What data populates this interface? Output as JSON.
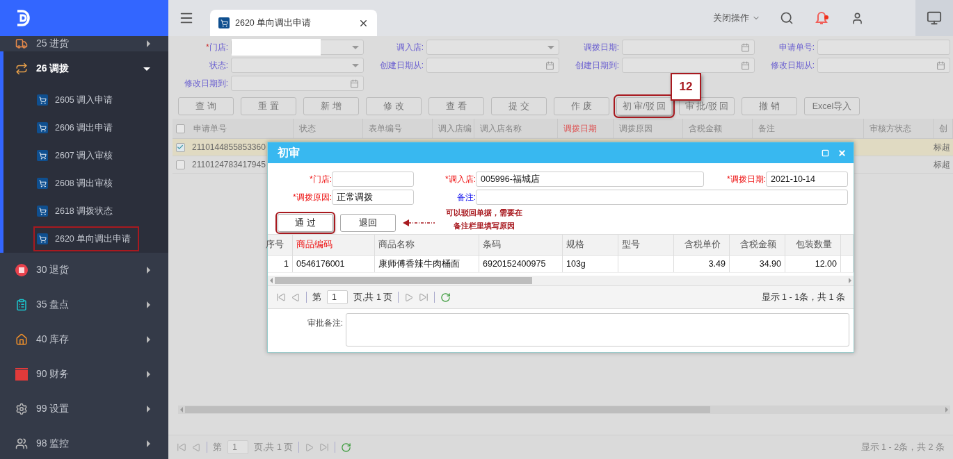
{
  "sidebar": {
    "items": [
      {
        "label": "25 进货",
        "expanded": false
      },
      {
        "label": "26 调拨",
        "expanded": true,
        "children": [
          {
            "label": "2605 调入申请",
            "annotated": false
          },
          {
            "label": "2606 调出申请",
            "annotated": false
          },
          {
            "label": "2607 调入审核",
            "annotated": false
          },
          {
            "label": "2608 调出审核",
            "annotated": false
          },
          {
            "label": "2618 调拨状态",
            "annotated": false
          },
          {
            "label": "2620 单向调出申请",
            "annotated": true
          }
        ]
      },
      {
        "label": "30 退货",
        "expanded": false
      },
      {
        "label": "35 盘点",
        "expanded": false
      },
      {
        "label": "40 库存",
        "expanded": false
      },
      {
        "label": "90 财务",
        "expanded": false
      },
      {
        "label": "99 设置",
        "expanded": false
      },
      {
        "label": "98 监控",
        "expanded": false
      }
    ]
  },
  "header": {
    "tabs": [
      {
        "label": "2620 单向调出申请",
        "selected": true
      }
    ],
    "close_menu": "关闭操作"
  },
  "filters": [
    {
      "marker": "*",
      "label": "门店:",
      "kind": "select"
    },
    {
      "label": "调入店:",
      "kind": "select"
    },
    {
      "label": "调拨日期:",
      "kind": "date"
    },
    {
      "label": "申请单号:",
      "kind": "text"
    },
    {
      "label": "状态:",
      "kind": "select"
    },
    {
      "label": "创建日期从:",
      "kind": "date"
    },
    {
      "label": "创建日期到:",
      "kind": "date"
    },
    {
      "label": "修改日期从:",
      "kind": "date"
    },
    {
      "label": "修改日期到:",
      "kind": "date"
    }
  ],
  "toolbar": {
    "buttons": [
      {
        "label": "查 询",
        "annotated": false
      },
      {
        "label": "重 置",
        "annotated": false
      },
      {
        "label": "新 增",
        "annotated": false
      },
      {
        "label": "修 改",
        "annotated": false
      },
      {
        "label": "查 看",
        "annotated": false
      },
      {
        "label": "提 交",
        "annotated": false
      },
      {
        "label": "作 废",
        "annotated": false
      },
      {
        "label": "初 审/驳 回",
        "annotated": true
      },
      {
        "label": "审 批/驳 回",
        "annotated": false
      },
      {
        "label": "撤 销",
        "annotated": false
      },
      {
        "label": "Excel导入",
        "annotated": false
      }
    ],
    "callout": "12"
  },
  "table": {
    "all_selected": false,
    "columns": [
      {
        "label": "申请单号",
        "required": false
      },
      {
        "label": "状态",
        "required": false
      },
      {
        "label": "表单编号",
        "required": false
      },
      {
        "label": "调入店编",
        "required": false
      },
      {
        "label": "调入店名称",
        "required": false
      },
      {
        "label": "调拨日期",
        "required": true
      },
      {
        "label": "调拨原因",
        "required": false
      },
      {
        "label": "含税金额",
        "required": false
      },
      {
        "label": "备注",
        "required": false
      },
      {
        "label": "审核方状态",
        "required": false
      },
      {
        "label": "创",
        "required": false
      }
    ],
    "rows": [
      {
        "selected": true,
        "order_no": "2110144855853360",
        "column_last": "标超"
      },
      {
        "selected": false,
        "order_no": "2110124783417945",
        "column_last": "标超"
      }
    ]
  },
  "pager": {
    "prefix": "第",
    "page": "1",
    "suffix": "页,共 1 页",
    "summary": "显示 1 - 2条，共 2 条"
  },
  "dialog": {
    "title": "初审",
    "fields": [
      {
        "label": "*门店:",
        "required": true
      },
      {
        "label": "*调入店:",
        "value": "005996-福城店",
        "required": true
      },
      {
        "label": "*调拨日期:",
        "value": "2021-10-14",
        "required": true
      },
      {
        "label": "*调拨原因:",
        "value": "正常调拨",
        "required": true
      },
      {
        "label": "备注:",
        "required": false
      }
    ],
    "buttons": [
      {
        "label": "通 过",
        "annotated": true
      },
      {
        "label": "退回",
        "annotated": false
      }
    ],
    "note": [
      "可以驳回单据，需要在",
      "备注栏里填写原因"
    ],
    "table": {
      "columns": [
        {
          "label": "序号",
          "required": false,
          "numeric": true
        },
        {
          "label": "商品编码",
          "required": true,
          "numeric": false
        },
        {
          "label": "商品名称",
          "required": false,
          "numeric": false
        },
        {
          "label": "条码",
          "required": false,
          "numeric": false
        },
        {
          "label": "规格",
          "required": false,
          "numeric": false
        },
        {
          "label": "型号",
          "required": false,
          "numeric": false
        },
        {
          "label": "含税单价",
          "required": false,
          "numeric": true
        },
        {
          "label": "含税金额",
          "required": false,
          "numeric": true
        },
        {
          "label": "包装数量",
          "required": false,
          "numeric": true
        }
      ],
      "rows": [
        [
          "1",
          "0546176001",
          "康师傅香辣牛肉桶面",
          "6920152400975",
          "103g",
          "",
          "3.49",
          "34.90",
          "12.00"
        ]
      ]
    },
    "pager": {
      "prefix": "第",
      "page": "1",
      "suffix": "页,共 1 页",
      "summary": "显示 1 - 1条，共 1 条"
    },
    "remark_label": "审批备注:"
  }
}
